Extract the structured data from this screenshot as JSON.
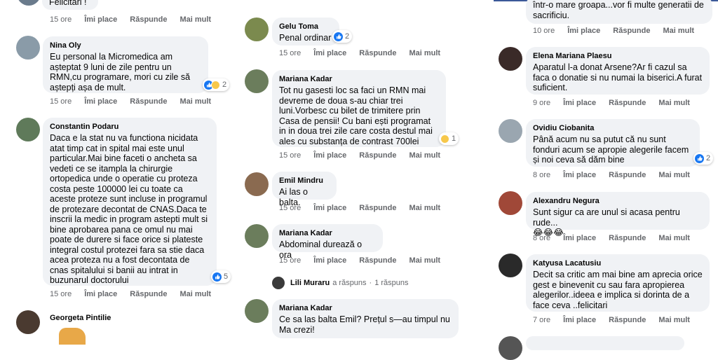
{
  "columns": [
    {
      "comments": [
        {
          "name": "",
          "text": "Felicitari !",
          "time": "15 ore",
          "like": "Îmi place",
          "reply": "Răspunde",
          "more": "Mai mult",
          "reaction_count": "",
          "avatar_color": "#6a7b8c"
        },
        {
          "name": "Nina Oly",
          "text": "Eu personal la Micromedica am așteptat 9 luni de zile pentru un RMN,cu programare, mori cu zile să aștepți așa de mult.",
          "time": "15 ore",
          "like": "Îmi place",
          "reply": "Răspunde",
          "more": "Mai mult",
          "reaction_count": "2",
          "avatar_color": "#8a9ba8"
        },
        {
          "name": "Constantin Podaru",
          "text": "Daca e la stat nu va functiona nicidata atat timp cat in spital mai este unul particular.Mai bine faceti o ancheta sa vedeti ce se itampla la chirurgie ortopedica unde o operatie cu proteza costa peste 100000 lei cu toate ca aceste proteze sunt incluse in programul de protezare decontat de CNAS.Daca te inscrii la medic in program astepti mult si bine aprobarea pana ce omul nu mai poate de durere si face orice si plateste integral costul protezei fara sa stie daca acea proteza nu a fost decontata de cnas spitalului si banii au intrat in buzunarul doctorului",
          "time": "15 ore",
          "like": "Îmi place",
          "reply": "Răspunde",
          "more": "Mai mult",
          "reaction_count": "5",
          "avatar_color": "#5f7a5a"
        },
        {
          "name": "Georgeta Pintilie",
          "text": "",
          "time": "",
          "like": "",
          "reply": "",
          "more": "",
          "reaction_count": "",
          "avatar_color": "#4a3a30"
        }
      ]
    },
    {
      "comments": [
        {
          "name": "Gelu Toma",
          "text": "Penal ordinar",
          "time": "15 ore",
          "like": "Îmi place",
          "reply": "Răspunde",
          "more": "Mai mult",
          "reaction_count": "2",
          "avatar_color": "#7b8a4e"
        },
        {
          "name": "Mariana Kadar",
          "text": "Tot nu gasesti loc sa faci un RMN mai devreme de doua s-au chiar trei luni.Vorbesc cu bilet de trimitere prin Casa de pensii! Cu bani ești programat in in doua trei zile care costa destul mai ales cu substanța de contrast 700lei",
          "time": "15 ore",
          "like": "Îmi place",
          "reply": "Răspunde",
          "more": "Mai mult",
          "reaction_count": "1",
          "avatar_color": "#6b7d5c"
        },
        {
          "name": "Emil Mindru",
          "text": "Ai las o balta.",
          "time": "15 ore",
          "like": "Îmi place",
          "reply": "Răspunde",
          "more": "Mai mult",
          "reaction_count": "",
          "avatar_color": "#8a6a50"
        },
        {
          "name": "Mariana Kadar",
          "text": "Abdominal durează o ora",
          "time": "15 ore",
          "like": "Îmi place",
          "reply": "Răspunde",
          "more": "Mai mult",
          "reaction_count": "",
          "avatar_color": "#6b7d5c"
        },
        {
          "name": "Mariana Kadar",
          "text": "Ce sa las balta Emil? Prețul s—au timpul nu Ma crezi!",
          "time": "",
          "like": "",
          "reply": "",
          "more": "",
          "reaction_count": "",
          "avatar_color": "#6b7d5c"
        }
      ],
      "reply_row": {
        "name": "Lili Muraru",
        "action": "a răspuns",
        "sep": "·",
        "count": "1 răspuns"
      }
    },
    {
      "comments": [
        {
          "name": "",
          "text": "într-o mare groapa...vor fi multe generatii de sacrificiu.",
          "time": "10 ore",
          "like": "Îmi place",
          "reply": "Răspunde",
          "more": "Mai mult",
          "reaction_count": "",
          "avatar_color": ""
        },
        {
          "name": "Elena Mariana Plaesu",
          "text": "Aparatul l-a donat Arsene?Ar fi cazul sa faca o donatie si nu numai la biserici.A furat suficient.",
          "time": "9 ore",
          "like": "Îmi place",
          "reply": "Răspunde",
          "more": "Mai mult",
          "reaction_count": "",
          "avatar_color": "#3a2a28"
        },
        {
          "name": "Ovidiu Ciobanita",
          "text": "Până acum nu sa putut că nu sunt fonduri acum se apropie alegerile facem și noi ceva să dăm bine",
          "time": "8 ore",
          "like": "Îmi place",
          "reply": "Răspunde",
          "more": "Mai mult",
          "reaction_count": "2",
          "avatar_color": "#9aa6b0"
        },
        {
          "name": "Alexandru Negura",
          "text": "Sunt sigur ca are unul si acasa pentru rude...",
          "emoji": "😂😂😂",
          "time": "8 ore",
          "like": "Îmi place",
          "reply": "Răspunde",
          "more": "Mai mult",
          "reaction_count": "",
          "avatar_color": "#a04838"
        },
        {
          "name": "Katyusa Lacatusiu",
          "text": "Decit sa critic am mai bine am aprecia orice gest e binevenit cu sau fara apropierea alegerilor..ideea e implica si dorinta de a face ceva ..felicitari",
          "time": "7 ore",
          "like": "Îmi place",
          "reply": "Răspunde",
          "more": "Mai mult",
          "reaction_count": "",
          "avatar_color": "#2a2a2a"
        }
      ]
    }
  ],
  "colors": {
    "bubble": "#f0f2f5",
    "meta": "#65676b",
    "like_blue": "#1877f2",
    "top_rule": "#3b5998"
  }
}
